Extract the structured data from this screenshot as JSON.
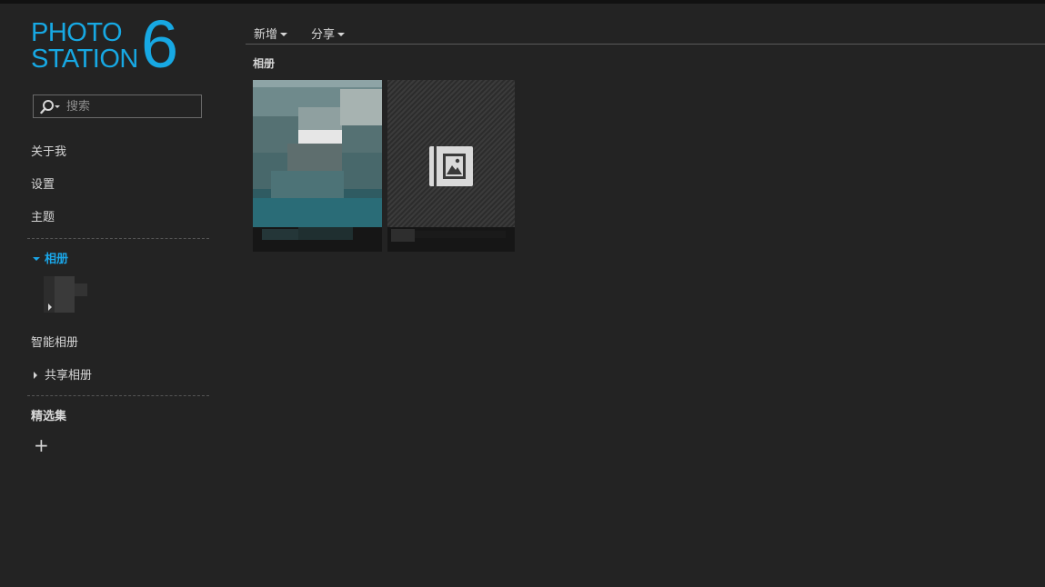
{
  "logo": {
    "line1": "PHOTO",
    "line2": "STATION",
    "version": "6",
    "color": "#17a8e3"
  },
  "search": {
    "placeholder": "搜索",
    "value": ""
  },
  "sidebar": {
    "items": [
      {
        "label": "关于我"
      },
      {
        "label": "设置"
      },
      {
        "label": "主题"
      }
    ],
    "albums_label": "相册",
    "smart_albums_label": "智能相册",
    "shared_albums_label": "共享相册",
    "featured_label": "精选集",
    "add_symbol": "+"
  },
  "toolbar": {
    "new_label": "新增",
    "share_label": "分享"
  },
  "main": {
    "section_title": "相册"
  },
  "colors": {
    "accent": "#1aa6e8",
    "background": "#232323",
    "text": "#d6d6d6"
  },
  "icons": [
    "search-icon",
    "album-placeholder-icon",
    "add-icon"
  ]
}
